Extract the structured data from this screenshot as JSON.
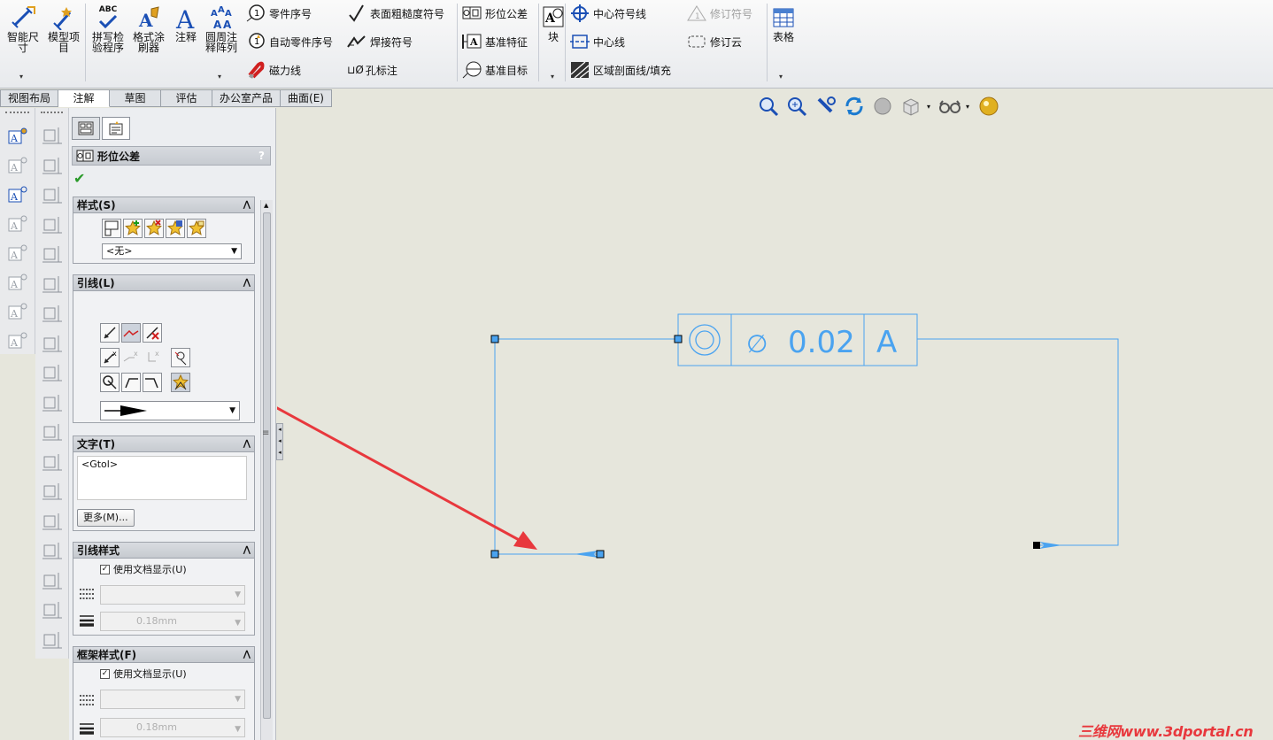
{
  "ribbon": {
    "smart_dim": "智能尺\n寸",
    "model_items": "模型项\n目",
    "spell_check": "拼写检\n验程序",
    "format_painter": "格式涂\n刷器",
    "note": "注释",
    "circular_note": "圆周注\n释阵列",
    "abc_label": "ABC",
    "balloon": "零件序号",
    "auto_balloon": "自动零件序号",
    "magnetic_line": "磁力线",
    "surface_finish": "表面粗糙度符号",
    "weld_symbol": "焊接符号",
    "hole_callout": "孔标注",
    "hole_callout_prefix": "⊔Ø",
    "geometric_tolerance": "形位公差",
    "datum_feature": "基准特征",
    "datum_target": "基准目标",
    "block": "块",
    "center_mark": "中心符号线",
    "centerline": "中心线",
    "area_hatch": "区域剖面线/填充",
    "revision_symbol": "修订符号",
    "revision_cloud": "修订云",
    "table": "表格"
  },
  "tabs": [
    {
      "label": "视图布局",
      "active": false
    },
    {
      "label": "注解",
      "active": true
    },
    {
      "label": "草图",
      "active": false
    },
    {
      "label": "评估",
      "active": false
    },
    {
      "label": "办公室产品",
      "active": false
    },
    {
      "label": "曲面(E)",
      "active": false
    }
  ],
  "pm": {
    "title": "形位公差",
    "help": "?",
    "style_group": "样式(S)",
    "style_dropdown": "<无>",
    "leader_group": "引线(L)",
    "text_group": "文字(T)",
    "text_value": "<Gtol>",
    "more_button": "更多(M)...",
    "leader_style_group": "引线样式",
    "use_doc_display": "使用文档显示(U)",
    "line_weight": "0.18mm",
    "frame_style_group": "框架样式(F)",
    "frame_use_doc_display": "使用文档显示(U)",
    "frame_line_weight": "0.18mm"
  },
  "drawing": {
    "tolerance_value": "0.02",
    "diameter_symbol": "∅",
    "datum": "A"
  },
  "watermark": "三维网www.3dportal.cn",
  "colors": {
    "annotation_blue": "#4aa3f0",
    "arrow_red": "#e8383d",
    "canvas_bg": "#e6e6dc"
  }
}
